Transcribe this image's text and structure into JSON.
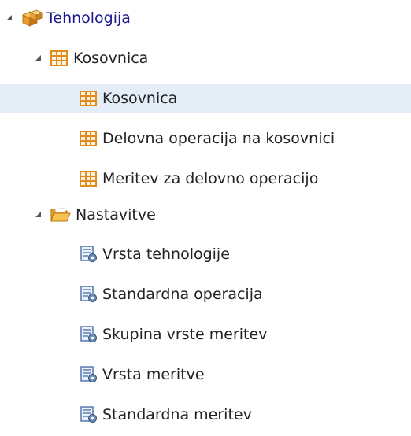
{
  "tree": {
    "root": {
      "label": "Tehnologija",
      "icon": "boxes-icon",
      "expanded": true,
      "color": "#1a1a8c"
    },
    "group_kosovnica": {
      "label": "Kosovnica",
      "icon": "table-grid-icon",
      "expanded": true,
      "items": [
        {
          "label": "Kosovnica",
          "icon": "table-grid-icon",
          "selected": true
        },
        {
          "label": "Delovna operacija na kosovnici",
          "icon": "table-grid-icon",
          "selected": false
        },
        {
          "label": "Meritev za delovno operacijo",
          "icon": "table-grid-icon",
          "selected": false
        }
      ]
    },
    "group_nastavitve": {
      "label": "Nastavitve",
      "icon": "folder-open-icon",
      "expanded": true,
      "items": [
        {
          "label": "Vrsta tehnologije",
          "icon": "settings-list-icon"
        },
        {
          "label": "Standardna operacija",
          "icon": "settings-list-icon"
        },
        {
          "label": "Skupina vrste meritev",
          "icon": "settings-list-icon"
        },
        {
          "label": "Vrsta meritve",
          "icon": "settings-list-icon"
        },
        {
          "label": "Standardna meritev",
          "icon": "settings-list-icon"
        }
      ]
    }
  },
  "colors": {
    "selected_background": "#e3eef9",
    "table_icon": "#e38b1e",
    "folder_icon": "#f2b233"
  }
}
